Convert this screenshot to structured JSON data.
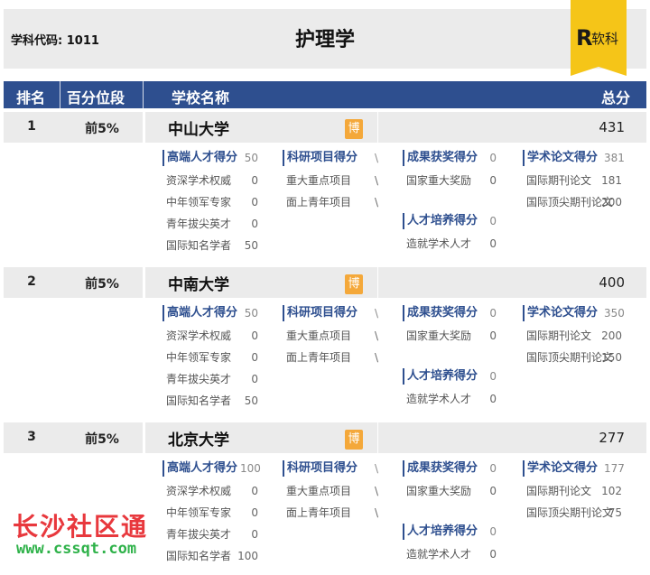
{
  "subject_code_label": "学科代码: 1011",
  "title": "护理学",
  "logo": {
    "mark": "R",
    "text": "软科",
    "color": "#f5c518"
  },
  "columns": {
    "rank": "排名",
    "percentile": "百分位段",
    "school": "学校名称",
    "total": "总分"
  },
  "colors": {
    "header": "#2e4f8f",
    "band": "#ebebeb",
    "badge": "#f4a83a"
  },
  "badge_label": "博",
  "schools": [
    {
      "rank": "1",
      "percentile": "前5%",
      "name": "中山大学",
      "total": "431",
      "talent": {
        "title": "高端人才得分",
        "score": "50",
        "items": [
          {
            "label": "资深学术权威",
            "value": "0"
          },
          {
            "label": "中年领军专家",
            "value": "0"
          },
          {
            "label": "青年拔尖英才",
            "value": "0"
          },
          {
            "label": "国际知名学者",
            "value": "50"
          }
        ]
      },
      "research": {
        "title": "科研项目得分",
        "score": "\\",
        "items": [
          {
            "label": "重大重点项目",
            "value": "\\"
          },
          {
            "label": "面上青年项目",
            "value": "\\"
          }
        ]
      },
      "award": {
        "title": "成果获奖得分",
        "score": "0",
        "items": [
          {
            "label": "国家重大奖励",
            "value": "0"
          }
        ]
      },
      "training": {
        "title": "人才培养得分",
        "score": "0",
        "items": [
          {
            "label": "造就学术人才",
            "value": "0"
          }
        ]
      },
      "paper": {
        "title": "学术论文得分",
        "score": "381",
        "items": [
          {
            "label": "国际期刊论文",
            "value": "181"
          },
          {
            "label": "国际顶尖期刊论文",
            "value": "200"
          }
        ]
      }
    },
    {
      "rank": "2",
      "percentile": "前5%",
      "name": "中南大学",
      "total": "400",
      "talent": {
        "title": "高端人才得分",
        "score": "50",
        "items": [
          {
            "label": "资深学术权威",
            "value": "0"
          },
          {
            "label": "中年领军专家",
            "value": "0"
          },
          {
            "label": "青年拔尖英才",
            "value": "0"
          },
          {
            "label": "国际知名学者",
            "value": "50"
          }
        ]
      },
      "research": {
        "title": "科研项目得分",
        "score": "\\",
        "items": [
          {
            "label": "重大重点项目",
            "value": "\\"
          },
          {
            "label": "面上青年项目",
            "value": "\\"
          }
        ]
      },
      "award": {
        "title": "成果获奖得分",
        "score": "0",
        "items": [
          {
            "label": "国家重大奖励",
            "value": "0"
          }
        ]
      },
      "training": {
        "title": "人才培养得分",
        "score": "0",
        "items": [
          {
            "label": "造就学术人才",
            "value": "0"
          }
        ]
      },
      "paper": {
        "title": "学术论文得分",
        "score": "350",
        "items": [
          {
            "label": "国际期刊论文",
            "value": "200"
          },
          {
            "label": "国际顶尖期刊论文",
            "value": "150"
          }
        ]
      }
    },
    {
      "rank": "3",
      "percentile": "前5%",
      "name": "北京大学",
      "total": "277",
      "talent": {
        "title": "高端人才得分",
        "score": "100",
        "items": [
          {
            "label": "资深学术权威",
            "value": "0"
          },
          {
            "label": "中年领军专家",
            "value": "0"
          },
          {
            "label": "青年拔尖英才",
            "value": "0"
          },
          {
            "label": "国际知名学者",
            "value": "100"
          }
        ]
      },
      "research": {
        "title": "科研项目得分",
        "score": "\\",
        "items": [
          {
            "label": "重大重点项目",
            "value": "\\"
          },
          {
            "label": "面上青年项目",
            "value": "\\"
          }
        ]
      },
      "award": {
        "title": "成果获奖得分",
        "score": "0",
        "items": [
          {
            "label": "国家重大奖励",
            "value": "0"
          }
        ]
      },
      "training": {
        "title": "人才培养得分",
        "score": "0",
        "items": [
          {
            "label": "造就学术人才",
            "value": "0"
          }
        ]
      },
      "paper": {
        "title": "学术论文得分",
        "score": "177",
        "items": [
          {
            "label": "国际期刊论文",
            "value": "102"
          },
          {
            "label": "国际顶尖期刊论文",
            "value": "75"
          }
        ]
      }
    }
  ],
  "watermark": {
    "name": "长沙社区通",
    "url": "www.cssqt.com"
  }
}
